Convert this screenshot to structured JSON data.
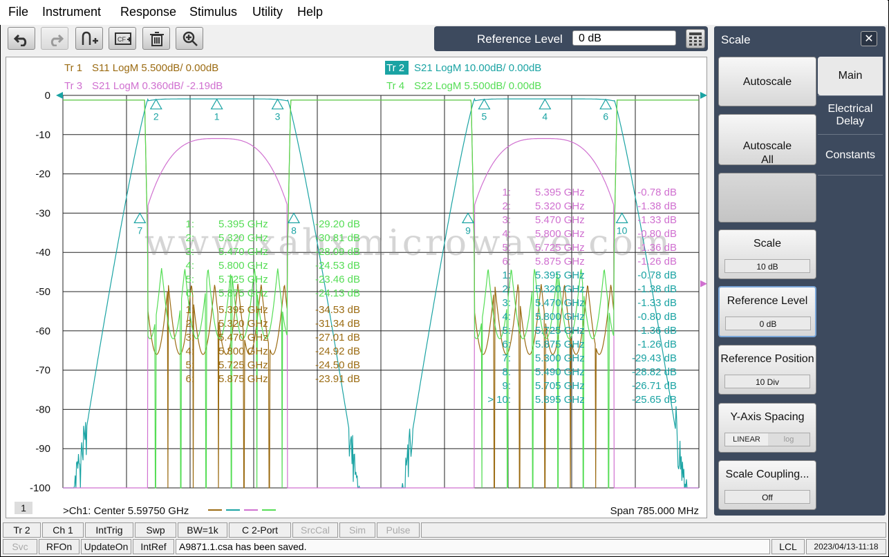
{
  "menu": [
    "File",
    "Instrument",
    "Response",
    "Stimulus",
    "Utility",
    "Help"
  ],
  "toolbar": {
    "buttons": [
      "undo-icon",
      "redo-icon",
      "add-marker-icon",
      "cal-icon",
      "delete-icon",
      "zoom-icon"
    ]
  },
  "ref_level": {
    "label": "Reference Level",
    "value": "0 dB"
  },
  "panel": {
    "title": "Scale",
    "close": "✕",
    "buttons": [
      {
        "label": "Autoscale"
      },
      {
        "label": "Autoscale\nAll"
      },
      {
        "label": ""
      },
      {
        "label": "Scale",
        "value": "10 dB"
      },
      {
        "label": "Reference Level",
        "value": "0 dB"
      },
      {
        "label": "Reference Position",
        "value": "10 Div"
      },
      {
        "label": "Y-Axis Spacing",
        "options": [
          "LINEAR",
          "log"
        ],
        "selected": "LINEAR"
      },
      {
        "label": "Scale Coupling...",
        "value": "Off"
      }
    ],
    "tabs": [
      "Main",
      "Electrical\nDelay",
      "Constants"
    ]
  },
  "chart_data": {
    "type": "line",
    "traces": [
      {
        "id": "Tr 1",
        "text": "S11 LogM 5.500dB/  0.00dB",
        "color": "#9b6b12"
      },
      {
        "id": "Tr 2",
        "text": "S21 LogM 10.00dB/  0.00dB",
        "color": "#1aa3a3"
      },
      {
        "id": "Tr 3",
        "text": "S21 LogM 0.360dB/  -2.19dB",
        "color": "#d070d0"
      },
      {
        "id": "Tr 4",
        "text": "S22 LogM 5.500dB/  0.00dB",
        "color": "#55dd55"
      }
    ],
    "ylim": [
      -100,
      0
    ],
    "yticks": [
      "0",
      "-10",
      "-20",
      "-30",
      "-40",
      "-50",
      "-60",
      "-70",
      "-80",
      "-90",
      "-100"
    ],
    "xlim_ghz": [
      5.205,
      5.99
    ],
    "center_label": ">Ch1:  Center  5.59750 GHz",
    "span_label": "Span  785.000 MHz",
    "channel": "1",
    "watermark": "www.xabxmicrowave.com",
    "marker_tables": [
      {
        "color": "#55dd55",
        "rows": [
          [
            "1:",
            "5.395  GHz",
            "-29.20 dB"
          ],
          [
            "2:",
            "5.320  GHz",
            "-30.81 dB"
          ],
          [
            "3:",
            "5.470  GHz",
            "-28.09 dB"
          ],
          [
            "4:",
            "5.800  GHz",
            "-24.53 dB"
          ],
          [
            "5:",
            "5.725  GHz",
            "-23.46 dB"
          ],
          [
            "6:",
            "5.875  GHz",
            "-24.13 dB"
          ]
        ]
      },
      {
        "color": "#9b6b12",
        "rows": [
          [
            "1:",
            "5.395  GHz",
            "-34.53 dB"
          ],
          [
            "2:",
            "5.320  GHz",
            "-31.34 dB"
          ],
          [
            "3:",
            "5.470  GHz",
            "-27.01 dB"
          ],
          [
            "4:",
            "5.800  GHz",
            "-24.92 dB"
          ],
          [
            "5:",
            "5.725  GHz",
            "-24.50 dB"
          ],
          [
            "6:",
            "5.875  GHz",
            "-23.91 dB"
          ]
        ]
      },
      {
        "color": "#d070d0",
        "rows": [
          [
            "1:",
            "5.395  GHz",
            "-0.78 dB"
          ],
          [
            "2:",
            "5.320  GHz",
            "-1.38 dB"
          ],
          [
            "3:",
            "5.470  GHz",
            "-1.33 dB"
          ],
          [
            "4:",
            "5.800  GHz",
            "-0.80 dB"
          ],
          [
            "5:",
            "5.725  GHz",
            "-1.36 dB"
          ],
          [
            "6:",
            "5.875  GHz",
            "-1.26 dB"
          ]
        ]
      },
      {
        "color": "#1aa3a3",
        "rows": [
          [
            "1:",
            "5.395  GHz",
            "-0.78 dB"
          ],
          [
            "2:",
            "5.320  GHz",
            "-1.38 dB"
          ],
          [
            "3:",
            "5.470  GHz",
            "-1.33 dB"
          ],
          [
            "4:",
            "5.800  GHz",
            "-0.80 dB"
          ],
          [
            "5:",
            "5.725  GHz",
            "-1.36 dB"
          ],
          [
            "6:",
            "5.875  GHz",
            "-1.26 dB"
          ],
          [
            "7:",
            "5.300  GHz",
            "-29.43 dB"
          ],
          [
            "8:",
            "5.490  GHz",
            "-28.82 dB"
          ],
          [
            "9:",
            "5.705  GHz",
            "-26.71 dB"
          ],
          [
            "> 10:",
            "5.895  GHz",
            "-25.65 dB"
          ]
        ]
      }
    ],
    "s21_markers": [
      {
        "n": "1",
        "f": 5.395,
        "db": -0.78
      },
      {
        "n": "2",
        "f": 5.32,
        "db": -1.38
      },
      {
        "n": "3",
        "f": 5.47,
        "db": -1.33
      },
      {
        "n": "4",
        "f": 5.8,
        "db": -0.8
      },
      {
        "n": "5",
        "f": 5.725,
        "db": -1.36
      },
      {
        "n": "6",
        "f": 5.875,
        "db": -1.26
      },
      {
        "n": "7",
        "f": 5.3,
        "db": -29.43
      },
      {
        "n": "8",
        "f": 5.49,
        "db": -28.82
      },
      {
        "n": "9",
        "f": 5.705,
        "db": -26.71
      },
      {
        "n": "10",
        "f": 5.895,
        "db": -25.65
      }
    ]
  },
  "status1": [
    "Tr 2",
    "Ch 1",
    "IntTrig",
    "Swp",
    "BW=1k",
    "C  2-Port",
    "SrcCal",
    "Sim",
    "Pulse"
  ],
  "status1_disabled": [
    "SrcCal",
    "Sim",
    "Pulse"
  ],
  "status2": [
    "Svc",
    "RFOn",
    "UpdateOn",
    "IntRef"
  ],
  "status2_disabled": [
    "Svc"
  ],
  "status_msg": "A9871.1.csa has been saved.",
  "status_lcl": "LCL",
  "status_time": "2023/04/13-11:18"
}
